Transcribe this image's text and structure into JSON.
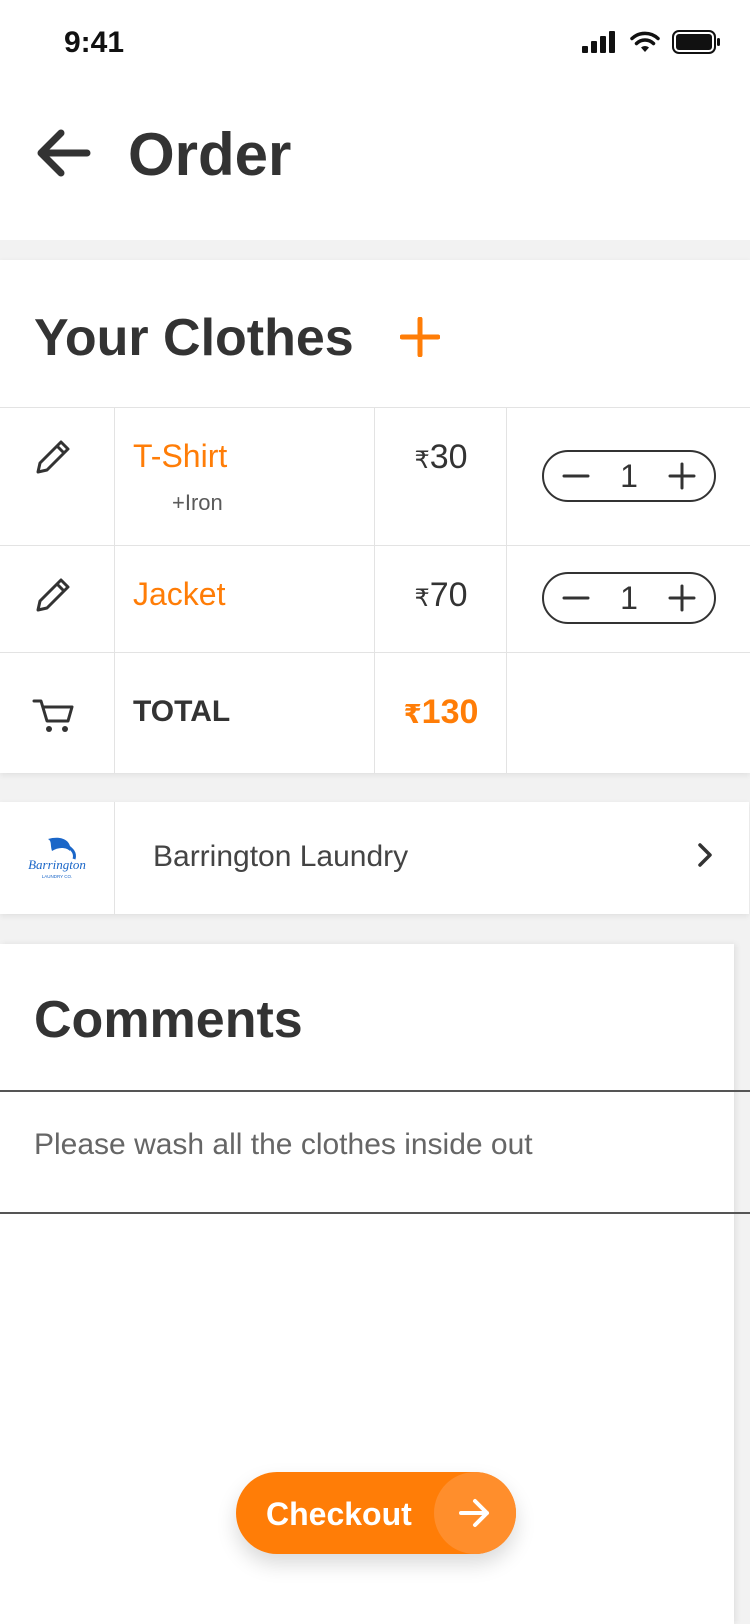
{
  "status_bar": {
    "time": "9:41"
  },
  "header": {
    "title": "Order"
  },
  "clothes": {
    "title": "Your Clothes",
    "items": [
      {
        "name": "T-Shirt",
        "extra": "+Iron",
        "currency": "₹",
        "price": "30",
        "quantity": "1"
      },
      {
        "name": "Jacket",
        "extra": "",
        "currency": "₹",
        "price": "70",
        "quantity": "1"
      }
    ],
    "total": {
      "label": "TOTAL",
      "currency": "₹",
      "amount": "130"
    }
  },
  "laundry": {
    "name": "Barrington Laundry",
    "logo_text": "Barrington",
    "logo_subtext": "LAUNDRY CO."
  },
  "comments": {
    "title": "Comments",
    "text": "Please wash all the clothes inside out"
  },
  "checkout": {
    "label": "Checkout"
  },
  "colors": {
    "accent": "#ff7d07",
    "text": "#333333"
  },
  "icons": [
    "back-arrow-icon",
    "plus-icon",
    "pencil-icon",
    "minus-icon",
    "cart-icon",
    "chevron-right-icon",
    "arrow-right-icon"
  ]
}
